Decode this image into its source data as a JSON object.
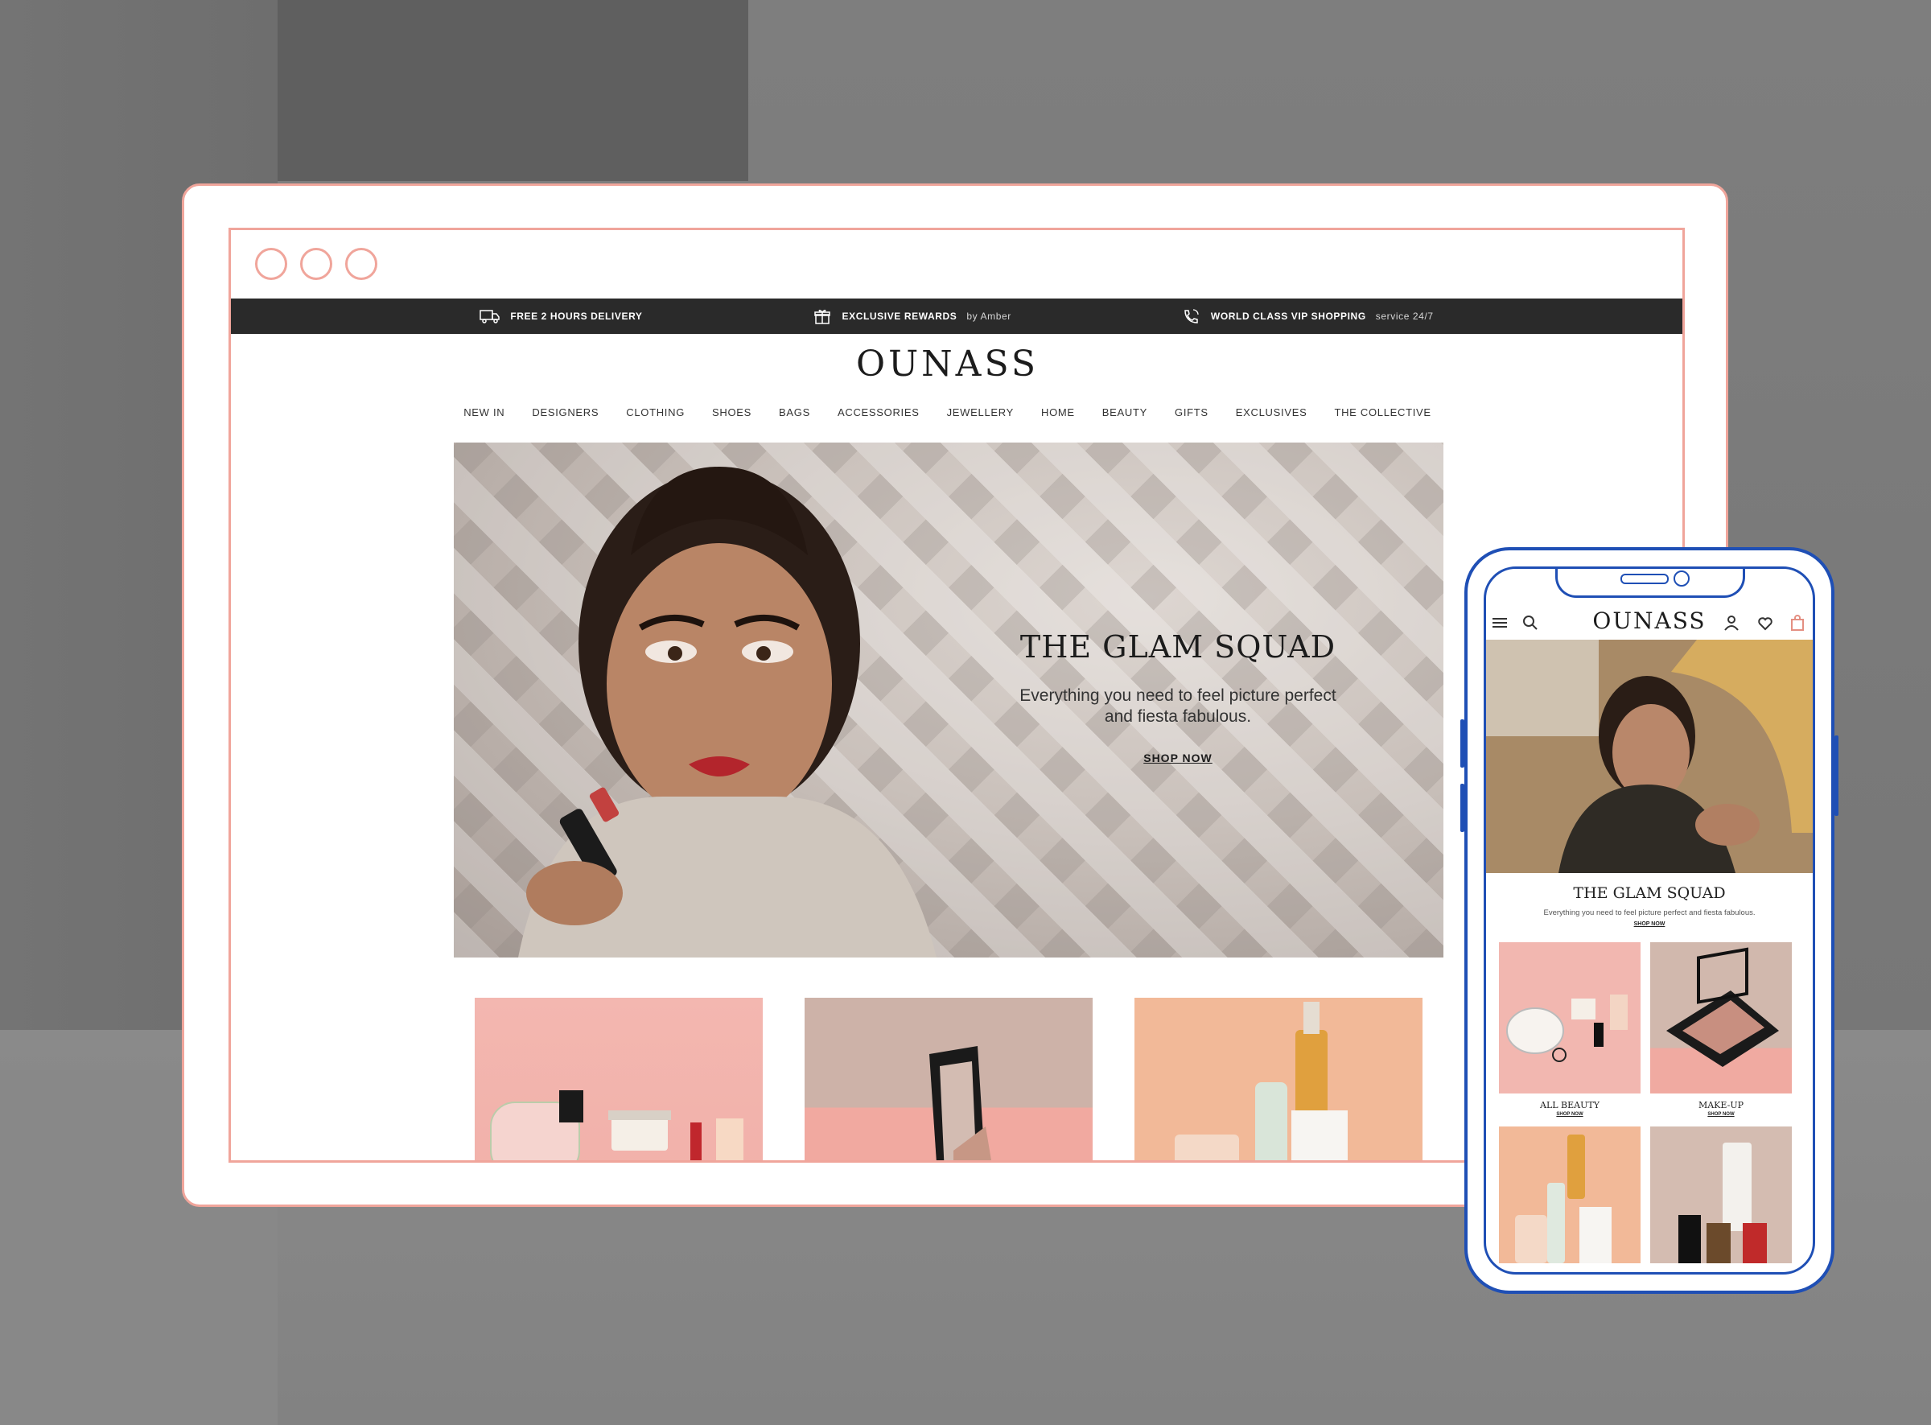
{
  "topbar": {
    "delivery": "FREE 2 HOURS DELIVERY",
    "rewards": "EXCLUSIVE REWARDS",
    "rewards_by": "by Amber",
    "vip": "WORLD CLASS VIP SHOPPING",
    "vip_sub": "service 24/7"
  },
  "site": {
    "logo": "OUNASS",
    "nav": [
      "NEW IN",
      "DESIGNERS",
      "CLOTHING",
      "SHOES",
      "BAGS",
      "ACCESSORIES",
      "JEWELLERY",
      "HOME",
      "BEAUTY",
      "GIFTS",
      "EXCLUSIVES",
      "THE COLLECTIVE"
    ]
  },
  "hero": {
    "title": "THE GLAM SQUAD",
    "text": "Everything you need to feel picture perfect and fiesta fabulous.",
    "cta": "SHOP NOW"
  },
  "mobile": {
    "logo": "OUNASS",
    "hero_title": "THE GLAM SQUAD",
    "hero_text": "Everything you need to feel picture perfect and fiesta fabulous.",
    "hero_cta": "SHOP NOW",
    "tiles": [
      {
        "label": "ALL BEAUTY",
        "cta": "SHOP NOW"
      },
      {
        "label": "MAKE-UP",
        "cta": "SHOP NOW"
      }
    ]
  },
  "colors": {
    "frame_pink": "#f0a59b",
    "phone_blue": "#1f4fb5",
    "topbar_dark": "#2a2a2a"
  }
}
